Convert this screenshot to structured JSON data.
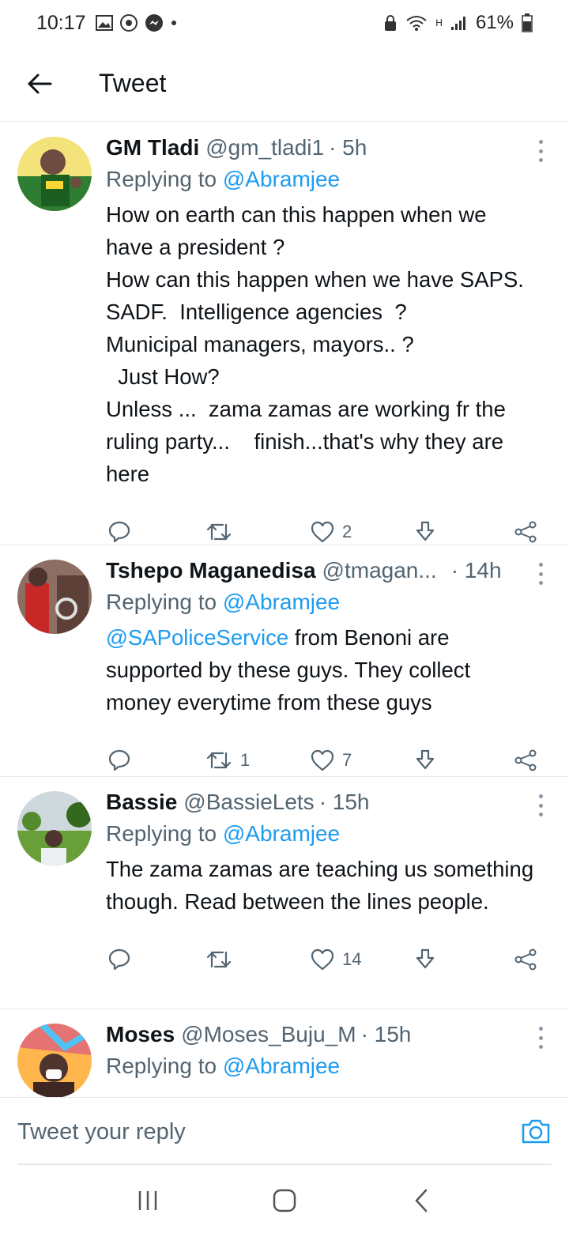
{
  "status_bar": {
    "time": "10:17",
    "battery": "61%",
    "network_label": "H"
  },
  "header": {
    "title": "Tweet",
    "back_icon": "arrow-left-icon"
  },
  "tweets": [
    {
      "name": "GM Tladi",
      "handle": "@gm_tladi1",
      "time": "· 5h",
      "replying_prefix": "Replying to ",
      "replying_to": "@Abramjee",
      "text": "How on earth can this happen when we have a president ?\nHow can this happen when we have SAPS. SADF.  Intelligence agencies  ?\nMunicipal managers, mayors.. ?\n  Just How?\nUnless ...  zama zamas are working fr the ruling party...    finish...that's why they are here",
      "replies": "",
      "retweets": "",
      "likes": "2"
    },
    {
      "name": "Tshepo Maganedisa",
      "handle": "@tmagan...",
      "time": "· 14h",
      "replying_prefix": "Replying to ",
      "replying_to": "@Abramjee",
      "text_mention": "@SAPoliceService",
      "text": " from Benoni are supported by these guys. They collect money everytime from these guys",
      "replies": "",
      "retweets": "1",
      "likes": "7"
    },
    {
      "name": "Bassie",
      "handle": "@BassieLets",
      "time": "· 15h",
      "replying_prefix": "Replying to ",
      "replying_to": "@Abramjee",
      "text": "The zama zamas are teaching us something though. Read between the lines people.",
      "replies": "",
      "retweets": "",
      "likes": "14"
    },
    {
      "name": "Moses",
      "handle": "@Moses_Buju_M",
      "time": "· 15h",
      "replying_prefix": "Replying to ",
      "replying_to": "@Abramjee"
    }
  ],
  "reply_bar": {
    "placeholder": "Tweet your reply"
  },
  "colors": {
    "link": "#1d9bf0",
    "secondary_text": "#536471",
    "primary_text": "#0f1419",
    "divider": "#e6e9ec"
  }
}
